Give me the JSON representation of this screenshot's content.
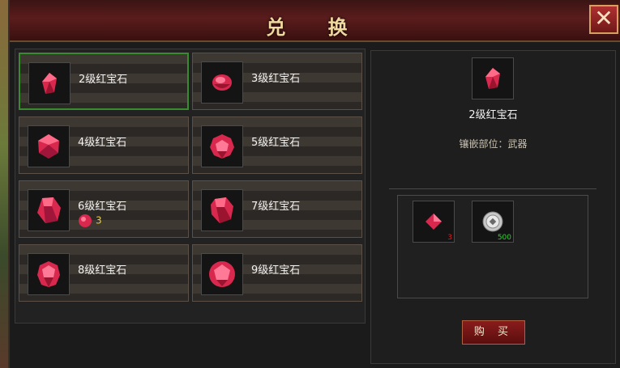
{
  "window": {
    "title": "兑 换",
    "close_icon": "✕"
  },
  "items": [
    {
      "name": "2级红宝石",
      "selected": true,
      "cost": ""
    },
    {
      "name": "3级红宝石",
      "selected": false,
      "cost": ""
    },
    {
      "name": "4级红宝石",
      "selected": false,
      "cost": ""
    },
    {
      "name": "5级红宝石",
      "selected": false,
      "cost": ""
    },
    {
      "name": "6级红宝石",
      "selected": false,
      "cost": "3"
    },
    {
      "name": "7级红宝石",
      "selected": false,
      "cost": ""
    },
    {
      "name": "8级红宝石",
      "selected": false,
      "cost": ""
    },
    {
      "name": "9级红宝石",
      "selected": false,
      "cost": ""
    }
  ],
  "detail": {
    "name": "2级红宝石",
    "slot_info": "镶嵌部位：武器",
    "costs": [
      {
        "icon": "ruby-shard-icon",
        "qty": "3",
        "qty_color": "#e02020"
      },
      {
        "icon": "silver-coin-icon",
        "qty": "500",
        "qty_color": "#30d030"
      }
    ],
    "buy_label": "购 买"
  },
  "colors": {
    "gem_red": "#e0305a",
    "selected_border": "#3a8a30",
    "title_gold": "#f0d8a0"
  }
}
